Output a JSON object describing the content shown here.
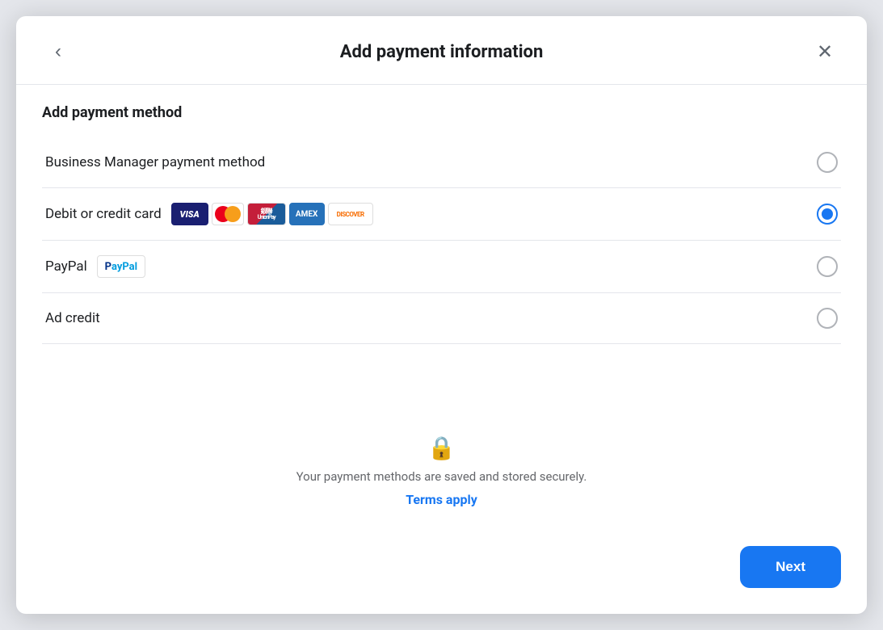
{
  "modal": {
    "title": "Add payment information",
    "back_label": "‹",
    "close_label": "✕"
  },
  "section": {
    "title": "Add payment method"
  },
  "payment_options": [
    {
      "id": "business_manager",
      "label": "Business Manager payment method",
      "selected": false,
      "has_card_icons": false,
      "has_paypal": false
    },
    {
      "id": "debit_credit",
      "label": "Debit or credit card",
      "selected": true,
      "has_card_icons": true,
      "has_paypal": false
    },
    {
      "id": "paypal",
      "label": "PayPal",
      "selected": false,
      "has_card_icons": false,
      "has_paypal": true
    },
    {
      "id": "ad_credit",
      "label": "Ad credit",
      "selected": false,
      "has_card_icons": false,
      "has_paypal": false
    }
  ],
  "security": {
    "text": "Your payment methods are saved and stored securely.",
    "terms_label": "Terms apply"
  },
  "footer": {
    "next_label": "Next"
  }
}
